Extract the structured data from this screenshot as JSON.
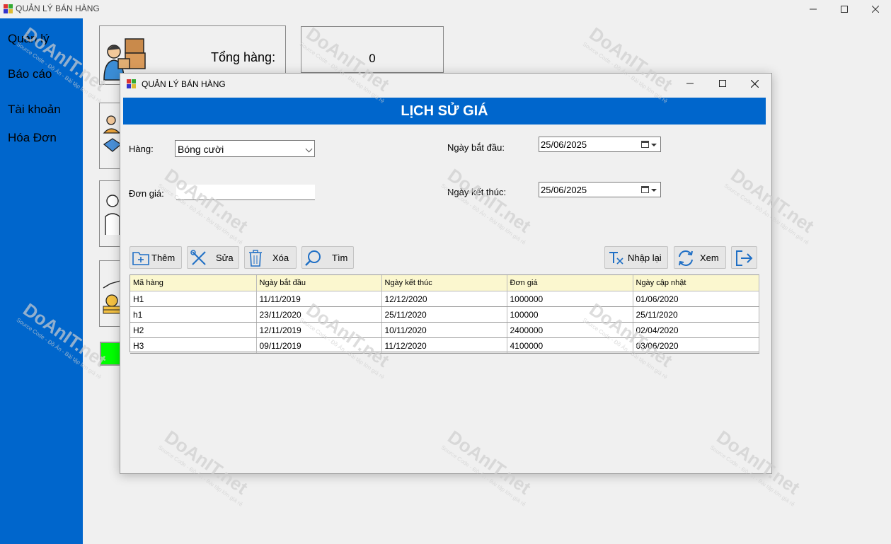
{
  "main": {
    "title": "QUẢN LÝ BÁN HÀNG",
    "sidebar": [
      "Quản lý",
      "Báo cáo",
      "Tài khoản",
      "Hóa Đơn"
    ],
    "stat_label": "Tổng hàng:",
    "stat_value": "0"
  },
  "dialog": {
    "title": "QUẢN LÝ BÁN HÀNG",
    "banner": "LỊCH SỬ GIÁ",
    "labels": {
      "hang": "Hàng:",
      "don_gia": "Đơn giá:",
      "ngay_bat_dau": "Ngày bắt đầu:",
      "ngay_ket_thuc": "Ngày kết thúc:"
    },
    "hang_value": "Bóng cười",
    "don_gia_value": "",
    "ngay_bat_dau_value": "25/06/2025",
    "ngay_ket_thuc_value": "25/06/2025",
    "buttons": {
      "them": "Thêm",
      "sua": "Sửa",
      "xoa": "Xóa",
      "tim": "Tìm",
      "nhap_lai": "Nhập lại",
      "xem": "Xem"
    },
    "table": {
      "headers": [
        "Mã hàng",
        "Ngày bắt đầu",
        "Ngày kết thúc",
        "Đơn giá",
        "Ngày cập nhật"
      ],
      "rows": [
        [
          "H1",
          "11/11/2019",
          "12/12/2020",
          "1000000",
          "01/06/2020"
        ],
        [
          "h1",
          "23/11/2020",
          "25/11/2020",
          "100000",
          "25/11/2020"
        ],
        [
          "H2",
          "12/11/2019",
          "10/11/2020",
          "2400000",
          "02/04/2020"
        ],
        [
          "H3",
          "09/11/2019",
          "11/12/2020",
          "4100000",
          "03/06/2020"
        ]
      ]
    }
  },
  "colors": {
    "sidebar": "#0066cc",
    "banner": "#0066cc",
    "header_row": "#fbf7cf",
    "green_button": "#00ff00"
  },
  "watermark": {
    "brand": "DoAnIT.net",
    "tagline": "Source Code - Đồ Án - Bài tập lớn giá rẻ"
  }
}
